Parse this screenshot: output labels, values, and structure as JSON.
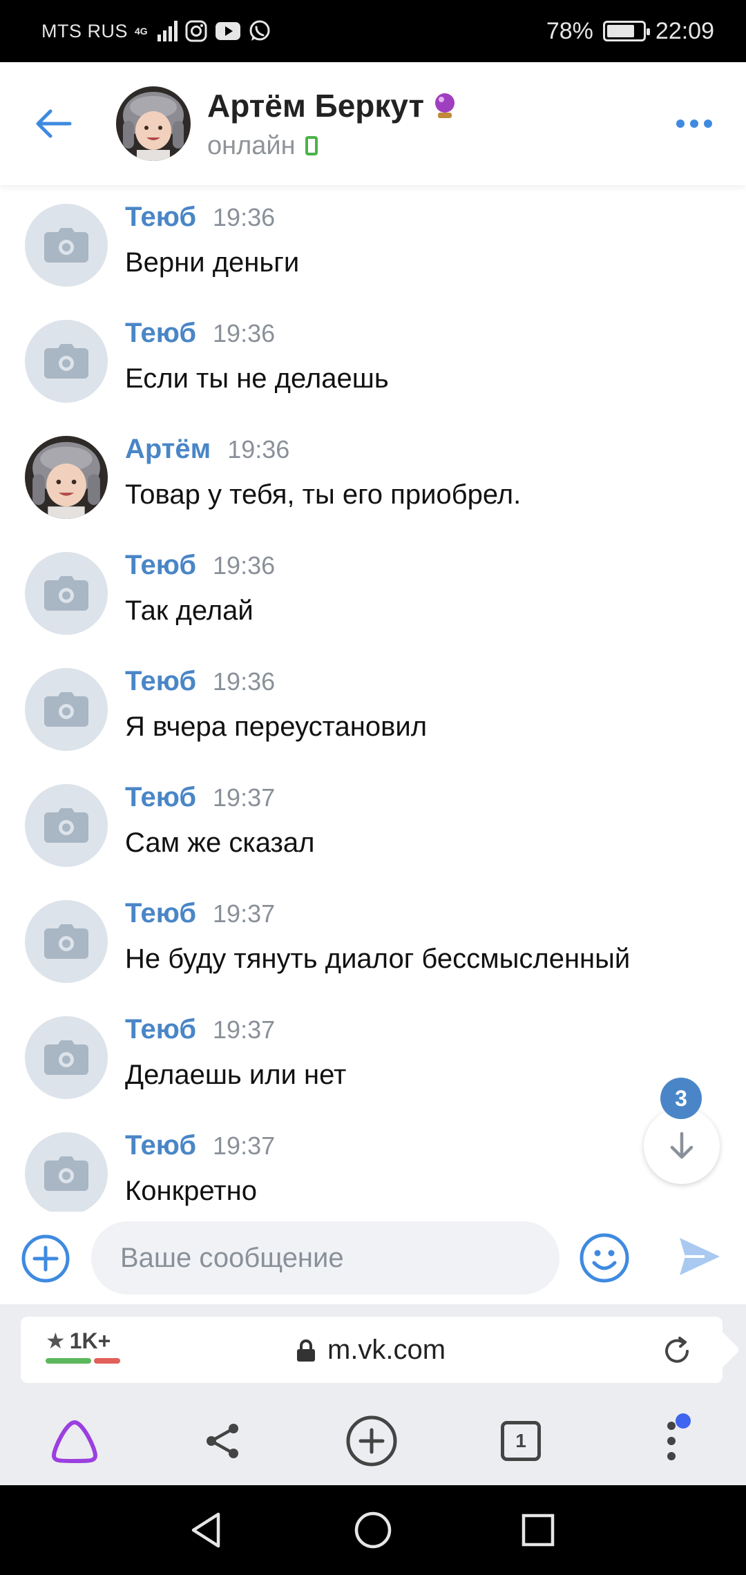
{
  "status_bar": {
    "carrier": "MTS RUS",
    "network": "4G",
    "battery": "78%",
    "battery_level": 0.78,
    "time": "22:09",
    "app_icons": [
      "instagram-icon",
      "youtube-icon",
      "whatsapp-icon"
    ]
  },
  "header": {
    "name": "Артём Беркут",
    "status": "онлайн",
    "badge_icon": "crystal-ball-icon"
  },
  "messages": [
    {
      "author": "Теюб",
      "time": "19:36",
      "text": "Верни деньги",
      "avatar": "camera-placeholder"
    },
    {
      "author": "Теюб",
      "time": "19:36",
      "text": "Если ты не делаешь",
      "avatar": "camera-placeholder"
    },
    {
      "author": "Артём",
      "time": "19:36",
      "text": "Товар у тебя, ты его приобрел.",
      "avatar": "photo"
    },
    {
      "author": "Теюб",
      "time": "19:36",
      "text": "Так делай",
      "avatar": "camera-placeholder"
    },
    {
      "author": "Теюб",
      "time": "19:36",
      "text": "Я вчера переустановил",
      "avatar": "camera-placeholder"
    },
    {
      "author": "Теюб",
      "time": "19:37",
      "text": "Сам же сказал",
      "avatar": "camera-placeholder"
    },
    {
      "author": "Теюб",
      "time": "19:37",
      "text": "Не буду тянуть диалог бессмысленный",
      "avatar": "camera-placeholder"
    },
    {
      "author": "Теюб",
      "time": "19:37",
      "text": "Делаешь или нет",
      "avatar": "camera-placeholder"
    },
    {
      "author": "Теюб",
      "time": "19:37",
      "text": "Конкретно",
      "avatar": "camera-placeholder"
    }
  ],
  "scroll_down": {
    "unread_count": "3"
  },
  "composer": {
    "placeholder": "Ваше сообщение"
  },
  "browser": {
    "rating": "1K+",
    "url": "m.vk.com",
    "tabs_count": "1"
  },
  "colors": {
    "accent": "#3f8ae0",
    "author": "#4a86c7",
    "online": "#4bb34b",
    "alice": "#9b3fe0",
    "send": "#a9c9f0"
  }
}
